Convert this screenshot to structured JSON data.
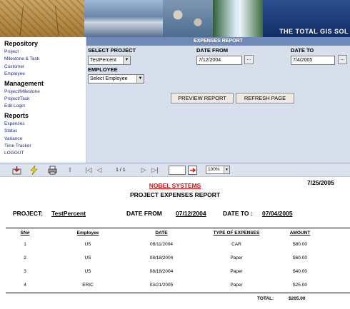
{
  "banner": {
    "tagline": "THE TOTAL GIS SOL"
  },
  "sidebar": {
    "sections": [
      {
        "title": "Repository",
        "items": [
          "Project",
          "Milestone & Task",
          "Customer",
          "Employee"
        ]
      },
      {
        "title": "Management",
        "items": [
          "Project/Milestone",
          "Project/Task",
          "Edit Login"
        ]
      },
      {
        "title": "Reports",
        "items": [
          "Expenses",
          "Status",
          "Variance",
          "Time Tracker",
          "LOGOUT"
        ]
      }
    ]
  },
  "form": {
    "header": "EXPENSES REPORT",
    "select_project_label": "SELECT PROJECT",
    "project_value": "TestPercent",
    "date_from_label": "DATE FROM",
    "date_from_value": "7/12/2004",
    "date_to_label": "DATE TO",
    "date_to_value": "7/4/2005",
    "dots_label": "...",
    "employee_label": "EMPLOYEE",
    "employee_value": "Select Employee",
    "preview_button": "PREVIEW REPORT",
    "refresh_button": "REFRESH PAGE"
  },
  "toolbar": {
    "page_indicator": "1 / 1",
    "page_input": "",
    "zoom": "100%",
    "icons": [
      "export-icon",
      "lightning-icon",
      "print-icon",
      "up-arrow-icon",
      "first-page-icon",
      "prev-page-icon",
      "next-page-icon",
      "last-page-icon",
      "go-icon"
    ]
  },
  "report": {
    "date": "7/25/2005",
    "company": "NOBEL SYSTEMS",
    "title": "PROJECT EXPENSES REPORT",
    "project_label": "PROJECT:",
    "project_value": "TestPercent",
    "date_from_label": "DATE FROM",
    "date_from_value": "07/12/2004",
    "date_to_label": "DATE TO :",
    "date_to_value": "07/04/2005",
    "columns": [
      "SN#",
      "Employee",
      "DATE",
      "TYPE OF EXPENSES",
      "AMOUNT"
    ],
    "rows": [
      [
        "1",
        "US",
        "08/11/2004",
        "CAR",
        "$80.00"
      ],
      [
        "2",
        "US",
        "08/18/2004",
        "Paper",
        "$60.00"
      ],
      [
        "3",
        "US",
        "08/18/2004",
        "Paper",
        "$40.00"
      ],
      [
        "4",
        "ERIC",
        "03/21/2005",
        "Paper",
        "$25.00"
      ]
    ],
    "total_label": "TOTAL:",
    "total_value": "$205.00"
  }
}
